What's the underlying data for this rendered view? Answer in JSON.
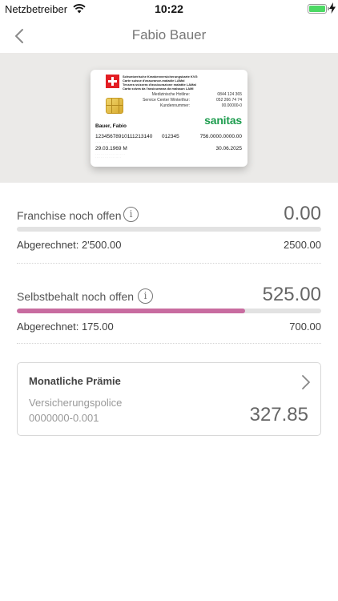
{
  "status_bar": {
    "carrier": "Netzbetreiber",
    "time": "10:22",
    "battery_color": "#4cd964"
  },
  "nav": {
    "title": "Fabio Bauer",
    "back_icon": "chevron-left-icon"
  },
  "card": {
    "header_lines": [
      "Schweizerische Krankenversicherungskarte KVG",
      "Carte suisse d'assurance-maladie LAMal",
      "Tessera svizzera d'assicurazione malattie LAMal",
      "Carta svizra da l'assicuranza da malsaun LAMI"
    ],
    "info_labels": [
      "Medizinische Hotline:",
      "Service Center Winterthur:",
      "Kundennummer:"
    ],
    "info_values": [
      "0844 124 365",
      "052 266 74 74",
      "00.00000-0"
    ],
    "brand": "sanitas",
    "brand_color": "#1d9c4e",
    "holder": "Bauer, Fabio",
    "card_number": "12345678910111213140",
    "insurer_code": "012345",
    "birth_date": "29.03.1969 M",
    "ahv_number": "756.0000.0000.00",
    "expiry": "30.06.2025"
  },
  "franchise": {
    "label": "Franchise noch offen",
    "value": "0.00",
    "billed_label": "Abgerechnet: 2'500.00",
    "total": "2500.00",
    "progress": 0
  },
  "selbstbehalt": {
    "label": "Selbstbehalt noch offen",
    "value": "525.00",
    "billed_label": "Abgerechnet: 175.00",
    "total": "700.00",
    "progress": 0.75,
    "progress_color": "#c86ca0"
  },
  "premium": {
    "title": "Monatliche Prämie",
    "policy_label": "Versicherungspolice",
    "policy_number": "0000000-0.001",
    "amount": "327.85"
  }
}
